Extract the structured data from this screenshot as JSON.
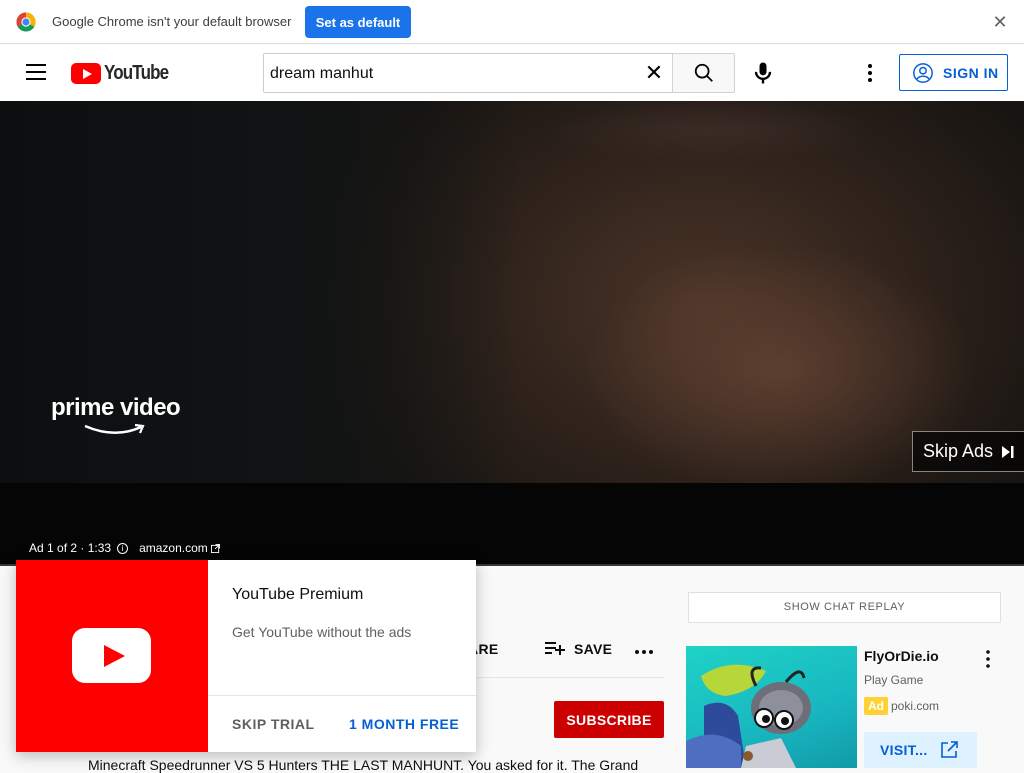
{
  "infobar": {
    "message": "Google Chrome isn't your default browser",
    "set_default_label": "Set as default"
  },
  "header": {
    "logo_text": "YouTube",
    "search_value": "dream manhut",
    "signin_label": "SIGN IN"
  },
  "player": {
    "brand_logo_text": "prime video",
    "skip_ads_label": "Skip Ads",
    "ad_counter": "Ad 1 of 2 · 1:33",
    "ad_domain": "amazon.com",
    "progress": 0
  },
  "video_actions": {
    "share_label": "SHARE",
    "save_label": "SAVE",
    "subscribe_label": "SUBSCRIBE"
  },
  "description": "Minecraft Speedrunner VS 5 Hunters THE LAST MANHUNT. You asked for it. The Grand",
  "sidebar": {
    "chat_replay_label": "SHOW CHAT REPLAY",
    "ad_card": {
      "title": "FlyOrDie.io",
      "subtitle": "Play Game",
      "badge": "Ad",
      "domain": "poki.com",
      "visit_label": "VISIT..."
    }
  },
  "premium_popup": {
    "title": "YouTube Premium",
    "description": "Get YouTube without the ads",
    "skip_label": "SKIP TRIAL",
    "cta_label": "1 MONTH FREE"
  },
  "colors": {
    "brand_red": "#ff0000",
    "subscribe_red": "#cc0000",
    "link_blue": "#065fd4",
    "chrome_blue": "#1a73e8",
    "ad_badge_yellow": "#ffd133",
    "progress_yellow": "#ffcc00"
  },
  "icons": [
    "chrome-icon",
    "close-icon",
    "menu-icon",
    "youtube-logo-icon",
    "search-icon",
    "mic-icon",
    "more-vert-icon",
    "account-icon",
    "skip-icon",
    "info-icon",
    "external-link-icon",
    "share-icon",
    "playlist-add-icon",
    "more-horiz-icon"
  ]
}
